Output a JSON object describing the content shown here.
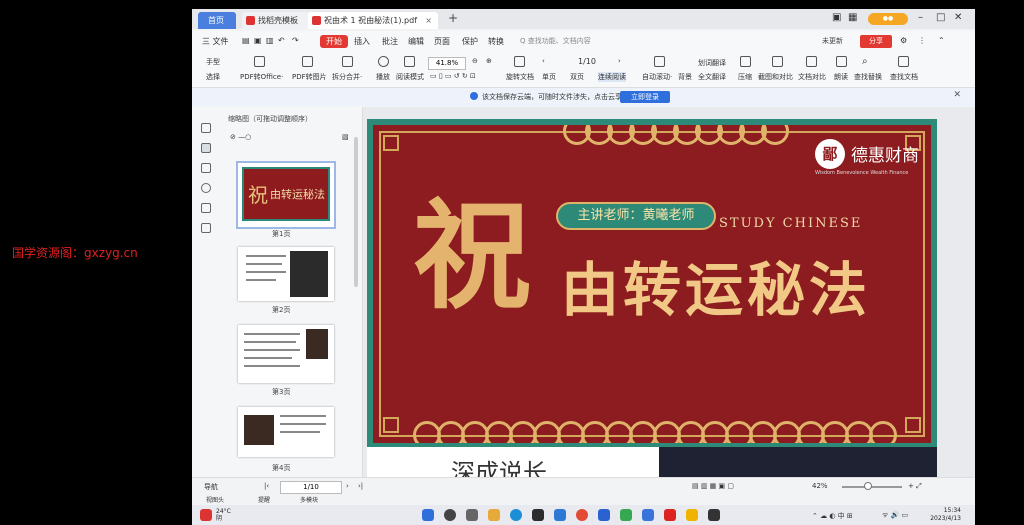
{
  "watermark": "国学资源阁：gxzyg.cn",
  "tabs": {
    "home": "首页",
    "t1": "找稻壳模板",
    "t2": "祝由术 1 祝由秘法(1).pdf",
    "add": "+"
  },
  "menu": {
    "file": "三 文件",
    "start": "开始",
    "insert": "插入",
    "annotate": "批注",
    "edit": "编辑",
    "page": "页面",
    "protect": "保护",
    "convert": "转换",
    "search": "Q 查找功能、文档内容",
    "not_saved": "未更新",
    "share": "分享"
  },
  "toolbar": {
    "hand": "手型",
    "select": "选择",
    "pdf_office": "PDF转Office·",
    "pdf_image": "PDF转图片",
    "split_merge": "拆分合并·",
    "play": "播放",
    "read_mode": "阅读模式",
    "zoom": "41.8%",
    "page": "1/10",
    "rotate": "旋转文档",
    "single": "单页",
    "double": "双页",
    "continuous": "连续阅读",
    "auto_scroll": "自动滚动·",
    "bg": "背景",
    "translate_word": "划词翻译",
    "translate_full": "全文翻译",
    "compress": "压缩",
    "screenshot": "截图和对比",
    "compare": "文档对比",
    "read_aloud": "朗读",
    "find_replace": "查找替换",
    "find_doc": "查找文档"
  },
  "notify": {
    "text": "该文档保存云端，可随时文件涉失，点击云享",
    "button": "立即登录"
  },
  "sidebar": {
    "header": "缩略图（可拖动调整顺序）",
    "pages": [
      "第1页",
      "第2页",
      "第3页",
      "第4页"
    ]
  },
  "slide": {
    "logo_name": "德惠财商",
    "logo_seal": "鄙",
    "logo_sub": "Wisdom Benevolence Wealth Finance",
    "teacher": "主讲老师：黄曦老师",
    "study": "STUDY CHINESE",
    "big_char": "祝",
    "title": "由转运秘法",
    "thumb_big": "祝",
    "thumb_title": "由转运秘法",
    "next_partial": "深成说长"
  },
  "status": {
    "nav": "导航",
    "page": "1/10",
    "zoom": "42%",
    "below1": "视图头",
    "below2": "提醒",
    "below3": "多模块"
  },
  "taskbar": {
    "weather1": "24°C",
    "weather2": "阴",
    "time": "15:34",
    "date": "2023/4/13"
  }
}
